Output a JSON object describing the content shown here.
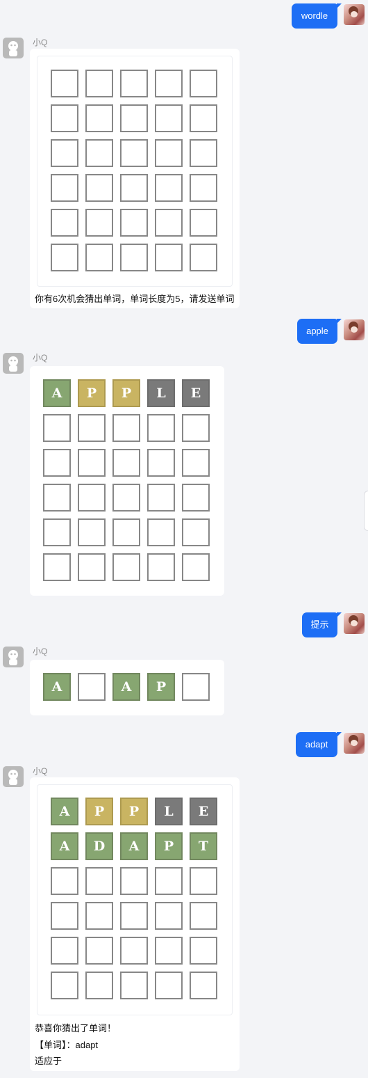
{
  "bot": {
    "name": "小Q"
  },
  "user_messages": [
    {
      "text": "wordle"
    },
    {
      "text": "apple"
    },
    {
      "text": "提示"
    },
    {
      "text": "adapt"
    }
  ],
  "bot_messages": [
    {
      "rows": [
        [
          "",
          "",
          "",
          "",
          ""
        ],
        [
          "",
          "",
          "",
          "",
          ""
        ],
        [
          "",
          "",
          "",
          "",
          ""
        ],
        [
          "",
          "",
          "",
          "",
          ""
        ],
        [
          "",
          "",
          "",
          "",
          ""
        ],
        [
          "",
          "",
          "",
          "",
          ""
        ]
      ],
      "states": [
        [
          "",
          "",
          "",
          "",
          ""
        ],
        [
          "",
          "",
          "",
          "",
          ""
        ],
        [
          "",
          "",
          "",
          "",
          ""
        ],
        [
          "",
          "",
          "",
          "",
          ""
        ],
        [
          "",
          "",
          "",
          "",
          ""
        ],
        [
          "",
          "",
          "",
          "",
          ""
        ]
      ],
      "lines": [
        "你有6次机会猜出单词，单词长度为5，请发送单词"
      ]
    },
    {
      "rows": [
        [
          "A",
          "P",
          "P",
          "L",
          "E"
        ],
        [
          "",
          "",
          "",
          "",
          ""
        ],
        [
          "",
          "",
          "",
          "",
          ""
        ],
        [
          "",
          "",
          "",
          "",
          ""
        ],
        [
          "",
          "",
          "",
          "",
          ""
        ],
        [
          "",
          "",
          "",
          "",
          ""
        ]
      ],
      "states": [
        [
          "g",
          "y",
          "y",
          "d",
          "d"
        ],
        [
          "",
          "",
          "",
          "",
          ""
        ],
        [
          "",
          "",
          "",
          "",
          ""
        ],
        [
          "",
          "",
          "",
          "",
          ""
        ],
        [
          "",
          "",
          "",
          "",
          ""
        ],
        [
          "",
          "",
          "",
          "",
          ""
        ]
      ],
      "lines": []
    },
    {
      "rows": [
        [
          "A",
          "",
          "A",
          "P",
          ""
        ]
      ],
      "states": [
        [
          "g",
          "",
          "g",
          "g",
          ""
        ]
      ],
      "lines": []
    },
    {
      "rows": [
        [
          "A",
          "P",
          "P",
          "L",
          "E"
        ],
        [
          "A",
          "D",
          "A",
          "P",
          "T"
        ],
        [
          "",
          "",
          "",
          "",
          ""
        ],
        [
          "",
          "",
          "",
          "",
          ""
        ],
        [
          "",
          "",
          "",
          "",
          ""
        ],
        [
          "",
          "",
          "",
          "",
          ""
        ]
      ],
      "states": [
        [
          "g",
          "y",
          "y",
          "d",
          "d"
        ],
        [
          "g",
          "g",
          "g",
          "g",
          "g"
        ],
        [
          "",
          "",
          "",
          "",
          ""
        ],
        [
          "",
          "",
          "",
          "",
          ""
        ],
        [
          "",
          "",
          "",
          "",
          ""
        ],
        [
          "",
          "",
          "",
          "",
          ""
        ]
      ],
      "lines": [
        "恭喜你猜出了单词！",
        "【单词】：adapt",
        "适应于"
      ]
    }
  ]
}
